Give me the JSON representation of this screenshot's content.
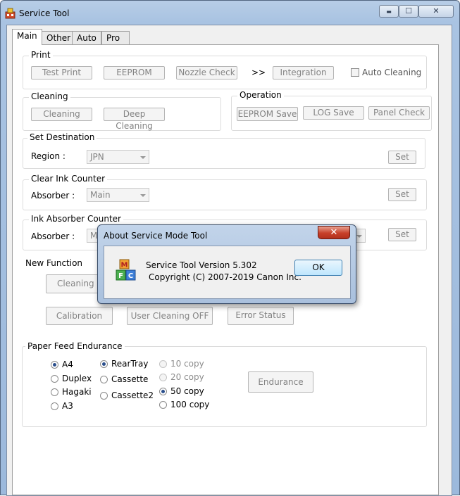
{
  "window": {
    "title": "Service Tool",
    "min_label": "▬",
    "max_label": "☐",
    "close_label": "✕"
  },
  "tabs": [
    {
      "label": "Main",
      "active": true
    },
    {
      "label": "Other"
    },
    {
      "label": "Auto"
    },
    {
      "label": "Pro"
    }
  ],
  "print": {
    "label": "Print",
    "test_print": "Test Print",
    "eeprom": "EEPROM",
    "nozzle_check": "Nozzle Check",
    "arrow": ">>",
    "integration": "Integration",
    "auto_cleaning": "Auto Cleaning"
  },
  "cleaning": {
    "label": "Cleaning",
    "cleaning_btn": "Cleaning",
    "deep_cleaning": "Deep Cleaning"
  },
  "operation": {
    "label": "Operation",
    "eeprom_save": "EEPROM Save",
    "log_save": "LOG Save",
    "panel_check": "Panel Check"
  },
  "destination": {
    "label": "Set Destination",
    "region_label": "Region :",
    "region_value": "JPN",
    "set": "Set"
  },
  "clear_ink": {
    "label": "Clear Ink Counter",
    "absorber_label": "Absorber :",
    "absorber_value": "Main",
    "set": "Set"
  },
  "ink_absorber": {
    "label": "Ink Absorber Counter",
    "absorber_label": "Absorber :",
    "absorber_value": "Ma",
    "set": "Set"
  },
  "new_function": {
    "label": "New Function",
    "cleaning_b": "Cleaning B",
    "calibration": "Calibration",
    "user_cleaning_off": "User Cleaning OFF",
    "error_status": "Error Status"
  },
  "paper_feed": {
    "label": "Paper Feed Endurance",
    "sizes": [
      "A4",
      "Duplex",
      "Hagaki",
      "A3"
    ],
    "size_selected": "A4",
    "trays": [
      "RearTray",
      "Cassette",
      "Cassette2"
    ],
    "tray_selected": "RearTray",
    "copies": [
      "10 copy",
      "20 copy",
      "50 copy",
      "100 copy"
    ],
    "copy_selected": "50 copy",
    "endurance": "Endurance"
  },
  "dialog": {
    "title": "About Service Mode Tool",
    "version": "Service Tool Version 5.302",
    "copyright": "Copyright (C) 2007-2019 Canon Inc.",
    "ok": "OK",
    "close": "✕",
    "icon_letters": "M F C"
  },
  "colors": {
    "title_bar": "#a9c3e2",
    "dialog_close": "#c7402a",
    "selected_radio": "#2b4f8c"
  }
}
